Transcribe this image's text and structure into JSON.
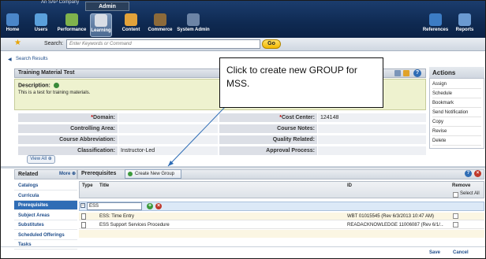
{
  "topbar": {
    "company": "An SAP Company",
    "admin_tab": "Admin",
    "nav_left": [
      {
        "label": "Home",
        "icon": "home-icon",
        "color": "#4a86c9"
      },
      {
        "label": "Users",
        "icon": "users-icon",
        "color": "#5aa0dc"
      },
      {
        "label": "Performance",
        "icon": "performance-icon",
        "color": "#7fb24c"
      },
      {
        "label": "Learning",
        "icon": "learning-icon",
        "color": "#d8dde5"
      },
      {
        "label": "Content",
        "icon": "content-icon",
        "color": "#e2a23a"
      },
      {
        "label": "Commerce",
        "icon": "commerce-icon",
        "color": "#8c6a3a"
      },
      {
        "label": "System Admin",
        "icon": "system-admin-icon",
        "color": "#6c84a6"
      }
    ],
    "nav_right": [
      {
        "label": "References",
        "icon": "references-icon",
        "color": "#3c7cc4"
      },
      {
        "label": "Reports",
        "icon": "reports-icon",
        "color": "#6b9ad1"
      }
    ]
  },
  "search": {
    "label": "Search:",
    "placeholder": "Enter Keywords or Command",
    "go": "Go"
  },
  "back_link": "Search Results",
  "detail": {
    "title": "Training Material Test",
    "description_label": "Description:",
    "description_text": "This is a test for training materials.",
    "left_fields": [
      {
        "label": "Domain:",
        "required": true,
        "value": ""
      },
      {
        "label": "Controlling Area:",
        "required": false,
        "value": ""
      },
      {
        "label": "Course Abbreviation:",
        "required": false,
        "value": ""
      },
      {
        "label": "Classification:",
        "required": false,
        "value": "Instructor-Led"
      }
    ],
    "right_fields": [
      {
        "label": "Cost Center:",
        "required": true,
        "value": "124148"
      },
      {
        "label": "Course Notes:",
        "required": false,
        "value": ""
      },
      {
        "label": "Quality Related:",
        "required": false,
        "value": ""
      },
      {
        "label": "Approval Process:",
        "required": false,
        "value": ""
      }
    ],
    "view_all": "View All"
  },
  "actions": {
    "title": "Actions",
    "items": [
      "Assign",
      "Schedule",
      "Bookmark",
      "Send Notification",
      "Copy",
      "Revise",
      "Delete"
    ]
  },
  "callout": {
    "text": "Click to create new GROUP for MSS."
  },
  "related": {
    "title": "Related",
    "more": "More",
    "items": [
      "Catalogs",
      "Curricula",
      "Prerequisites",
      "Subject Areas",
      "Substitutes",
      "Scheduled Offerings",
      "Tasks"
    ],
    "selected": "Prerequisites"
  },
  "prerequisites": {
    "title": "Prerequisites",
    "create_group": "Create New Group",
    "columns": {
      "type": "Type",
      "title": "Title",
      "id": "ID",
      "remove": "Remove",
      "select_all": "Select All"
    },
    "group_name": "ESS",
    "rows": [
      {
        "title": "ESS: Time Entry",
        "id": "WBT 01015545 (Rev 6/3/2013 10:47 AM)"
      },
      {
        "title": "ESS Support Services Procedure",
        "id": "READACKNOWLEDGE 11006087 (Rev 6/1/..."
      }
    ]
  },
  "footer": {
    "save": "Save",
    "cancel": "Cancel"
  }
}
